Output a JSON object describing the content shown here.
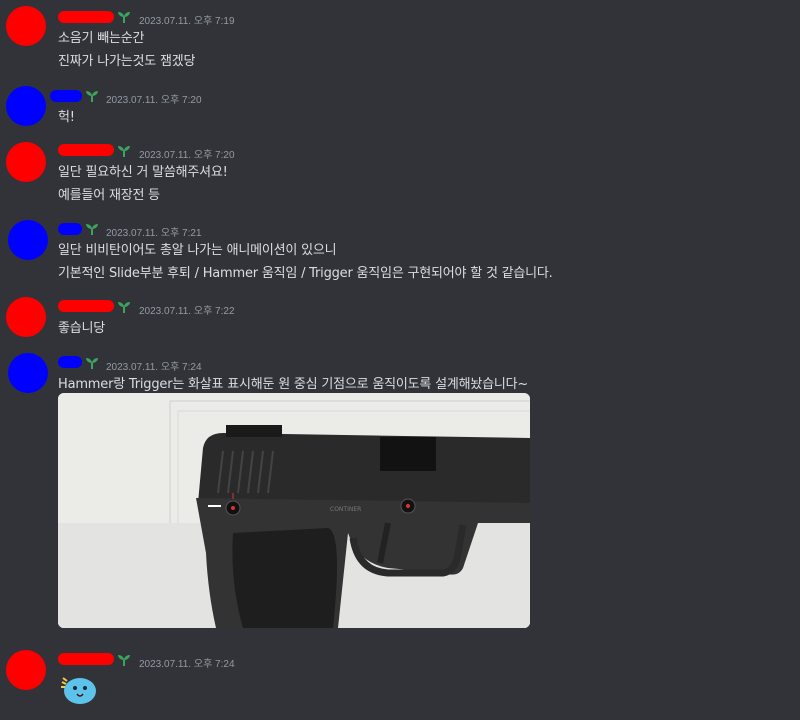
{
  "colors": {
    "red_user": "#ff0000",
    "blue_user": "#0000ff",
    "accent_green": "#3ba55d"
  },
  "messages": [
    {
      "user": "red",
      "time": "2023.07.11. 오후 7:19",
      "lines": [
        "소음기 빼는순간",
        "진짜가 나가는것도 잼겠당"
      ]
    },
    {
      "user": "blue",
      "time": "2023.07.11. 오후 7:20",
      "lines": [
        "헉!"
      ]
    },
    {
      "user": "red",
      "time": "2023.07.11. 오후 7:20",
      "lines": [
        "일단 필요하신 거 말씀해주셔요!",
        "예를들어 재장전 등"
      ]
    },
    {
      "user": "blue",
      "time": "2023.07.11. 오후 7:21",
      "lines": [
        "일단 비비탄이어도 총알 나가는 애니메이션이 있으니",
        "기본적인 Slide부분 후퇴 / Hammer 움직임 / Trigger 움직임은 구현되어야 할 것 같습니다."
      ]
    },
    {
      "user": "red",
      "time": "2023.07.11. 오후 7:22",
      "lines": [
        "좋습니당"
      ]
    },
    {
      "user": "blue",
      "time": "2023.07.11. 오후 7:24",
      "lines": [
        "Hammer랑 Trigger는 화살표 표시해둔 원 중심 기점으로 움직이도록 설계해놨습니다~"
      ]
    },
    {
      "user": "red",
      "time": "2023.07.11. 오후 7:24",
      "lines": []
    }
  ],
  "attachment": {
    "icon": "pistol-model-screenshot",
    "engraving": "CONTINER"
  },
  "sticker": {
    "icon": "blue-blob-emoji"
  }
}
